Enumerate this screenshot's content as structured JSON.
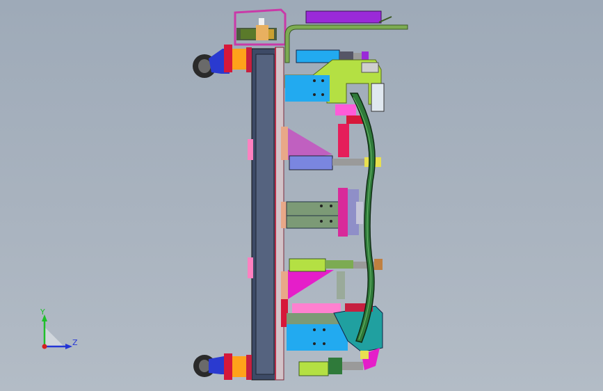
{
  "viewport": {
    "background": "#a6b0bc"
  },
  "triad": {
    "y_label": "Y",
    "z_label": "Z",
    "y_color": "#1fbf2a",
    "z_color": "#2436d6",
    "x_color": "#d42020"
  },
  "model": {
    "colors": {
      "frame": "#3d4a66",
      "frame_dark": "#1e2533",
      "pink": "#ff5bd8",
      "magenta": "#e51ec9",
      "blue": "#22aaf0",
      "sage": "#7c9a76",
      "lime": "#b4e043",
      "olive": "#8da33e",
      "purple": "#9a2ad8",
      "orange": "#ffa21a",
      "red": "#d6183a",
      "green_part": "#2f7a3a",
      "teal": "#20a0a0"
    }
  }
}
